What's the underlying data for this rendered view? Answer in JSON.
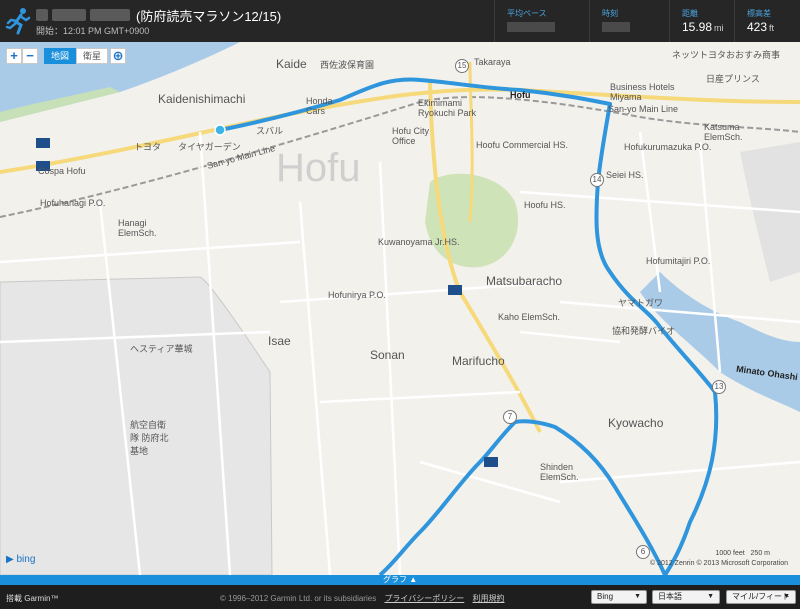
{
  "header": {
    "title": "(防府読売マラソン12/15)",
    "subtitle": "開始：12:01 PM GMT+0900",
    "stats": [
      {
        "label": "平均ペース",
        "value": "",
        "unit": ""
      },
      {
        "label": "時刻",
        "value": "",
        "unit": ""
      },
      {
        "label": "距離",
        "value": "15.98",
        "unit": "mi"
      },
      {
        "label": "標高差",
        "value": "423",
        "unit": "ft"
      }
    ]
  },
  "map": {
    "zoom_in": "+",
    "zoom_out": "−",
    "type_map": "地図",
    "type_satellite": "衛星",
    "labels": {
      "kaide": "Kaide",
      "kaidenishimachi": "Kaidenishimachi",
      "hofu": "Hofu",
      "hofu_watermark": "Hofu",
      "sanyo_main_line_1": "San-yo Main Line",
      "sanyo_main_line_2": "San-yo Main Line",
      "takaraya": "Takaraya",
      "nettsu_toyota": "ネッツトヨタ",
      "osumi_shoji": "おおすみ商事",
      "business_hotels": "Business Hotels Miyama",
      "nissan_prince": "日産プリンス",
      "ekimimami": "Ekimimami Ryokuchi Park",
      "hofu_city_office": "Hofu City Office",
      "hofu_commercial": "Hoofu Commercial HS.",
      "hofu_hs": "Hoofu HS.",
      "sonan": "Sonan",
      "isae": "Isae",
      "marifucho": "Marifucho",
      "matsubaracho": "Matsubaracho",
      "kyowacho": "Kyowacho",
      "minato_ohashi": "Minato Ohashi",
      "kuwanoyama": "Kuwanoyama Jr.HS.",
      "hofunirya": "Hofunirya P.O.",
      "kaho": "Kaho ElemSch.",
      "cospa": "Cospa Hofu",
      "hofunagi": "Hofuhanagi P.O.",
      "hanagi": "Hanagi ElemSch.",
      "kaide_school": "西佐波保育園",
      "hestia": "ヘスティア華城",
      "air_base": "航空自衛隊 防府北基地",
      "toyota": "トヨタ",
      "tire_garden": "タイヤガーデン",
      "subaru": "スバル",
      "honda": "Honda Cars",
      "seiei": "Seiei HS.",
      "hofumitajiri": "Hofumitajiri P.O.",
      "hofukurumazuka": "Hofukurumazuka P.O.",
      "katsuma": "Katsuma ElemSch.",
      "shinden": "Shinden ElemSch.",
      "yamatogawa": "ヤマトガワ",
      "kyowa_hakko": "協和発酵バイオ",
      "bing": "bing"
    },
    "scale_feet": "1000 feet",
    "scale_m": "250 m",
    "copyright": "© 2012 Zenrin   © 2013 Microsoft Corporation",
    "markers": [
      "15",
      "14",
      "13",
      "7",
      "6"
    ],
    "route_color": "#2f95dc"
  },
  "graph_tab": "グラフ ▲",
  "footer": {
    "brand": "搭載 Garmin™",
    "copyright": "© 1996–2012 Garmin Ltd. or its subsidiaries",
    "privacy": "プライバシーポリシー",
    "terms": "利用規約",
    "select_service": "Bing",
    "select_language": "日本語",
    "select_units": "マイル/フィート"
  }
}
